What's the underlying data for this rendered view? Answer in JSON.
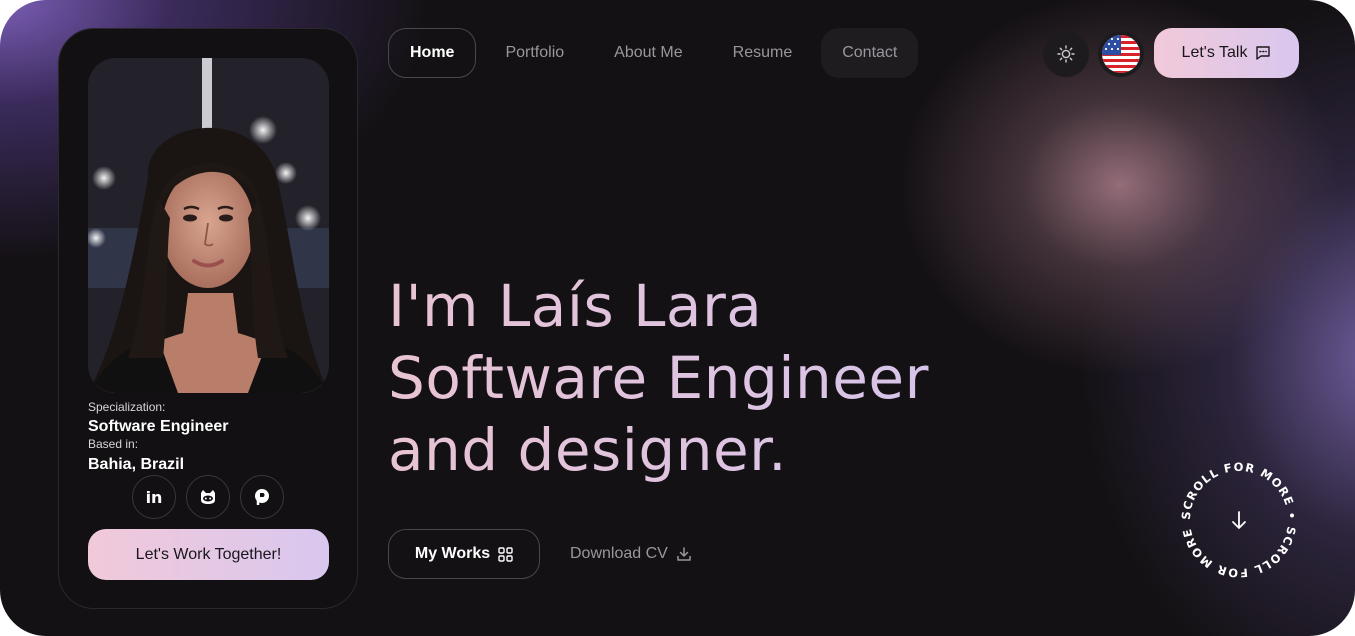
{
  "nav": {
    "items": [
      {
        "label": "Home"
      },
      {
        "label": "Portfolio"
      },
      {
        "label": "About Me"
      },
      {
        "label": "Resume"
      },
      {
        "label": "Contact"
      }
    ],
    "active": "Home",
    "theme_icon": "sun-icon",
    "language_icon": "us-flag-icon",
    "cta_label": "Let's Talk",
    "cta_icon": "chat-icon"
  },
  "profile": {
    "specialization_label": "Specialization:",
    "specialization": "Software Engineer",
    "based_label": "Based in:",
    "location": "Bahia, Brazil",
    "socials": [
      {
        "icon": "linkedin-icon",
        "glyph": "in"
      },
      {
        "icon": "github-icon"
      },
      {
        "icon": "product-hunt-icon"
      }
    ],
    "cta_label": "Let's Work Together!"
  },
  "hero": {
    "line1": "I'm Laís Lara",
    "line2": "Software Engineer",
    "line3": "and designer."
  },
  "actions": {
    "works_label": "My Works",
    "works_icon": "grid-icon",
    "cv_label": "Download CV",
    "cv_icon": "download-icon"
  },
  "scroll": {
    "text": "SCROLL FOR MORE • SCROLL FOR MORE • ",
    "icon": "arrow-down-icon"
  },
  "colors": {
    "background": "#141114",
    "accent_pink": "#f1c9d9",
    "accent_lavender": "#d9c7ef",
    "muted_text": "#9a969d"
  }
}
